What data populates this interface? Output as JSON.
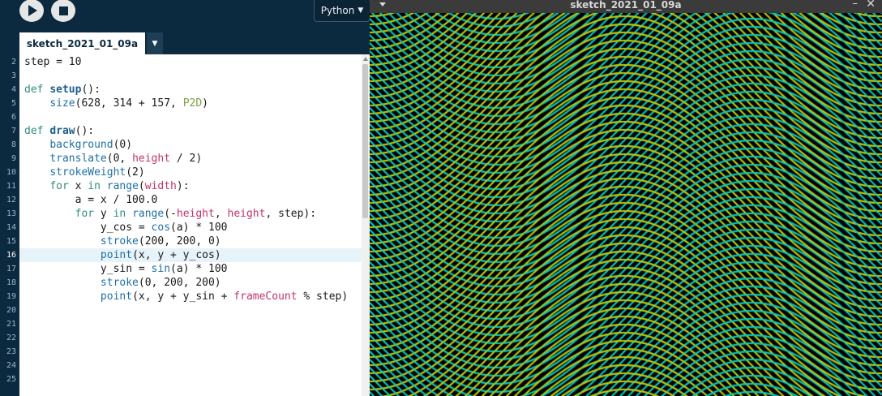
{
  "toolbar": {
    "run_icon": "play-icon",
    "stop_icon": "stop-icon",
    "mode_label": "Python",
    "mode_caret": "▼"
  },
  "tab": {
    "label": "sketch_2021_01_09a",
    "menu_caret": "▼"
  },
  "editor": {
    "active_line": "16",
    "line_numbers": [
      "2",
      "3",
      "4",
      "5",
      "6",
      "7",
      "8",
      "9",
      "10",
      "11",
      "12",
      "13",
      "14",
      "15",
      "16",
      "17",
      "18",
      "19",
      "20",
      "21",
      "22",
      "23",
      "24",
      "25"
    ],
    "colors": {
      "background": "#ffffff",
      "gutter": "#0b2a40",
      "highlight": "#e6f4fa"
    }
  },
  "sketch_window": {
    "title": "sketch_2021_01_09a",
    "minimize": "–",
    "close": "✕",
    "menu_icon": "menu-caret-icon",
    "colors": {
      "background": "#000000",
      "yellow_stroke": "#c8c800",
      "cyan_stroke": "#00c8c8"
    }
  },
  "code": [
    [
      [
        "plain",
        "step = 10"
      ]
    ],
    [],
    [
      [
        "kw",
        "def"
      ],
      [
        "plain",
        " "
      ],
      [
        "fn",
        "setup"
      ],
      [
        "plain",
        "():"
      ]
    ],
    [
      [
        "plain",
        "    "
      ],
      [
        "bi",
        "size"
      ],
      [
        "plain",
        "(628, 314 + 157, "
      ],
      [
        "lit",
        "P2D"
      ],
      [
        "plain",
        ")"
      ]
    ],
    [],
    [
      [
        "kw",
        "def"
      ],
      [
        "plain",
        " "
      ],
      [
        "fn",
        "draw"
      ],
      [
        "plain",
        "():"
      ]
    ],
    [
      [
        "plain",
        "    "
      ],
      [
        "bi",
        "background"
      ],
      [
        "plain",
        "(0)"
      ]
    ],
    [
      [
        "plain",
        "    "
      ],
      [
        "bi",
        "translate"
      ],
      [
        "plain",
        "(0, "
      ],
      [
        "vr",
        "height"
      ],
      [
        "plain",
        " / 2)"
      ]
    ],
    [
      [
        "plain",
        "    "
      ],
      [
        "bi",
        "strokeWeight"
      ],
      [
        "plain",
        "(2)"
      ]
    ],
    [
      [
        "plain",
        "    "
      ],
      [
        "kw",
        "for"
      ],
      [
        "plain",
        " x "
      ],
      [
        "kw",
        "in"
      ],
      [
        "plain",
        " "
      ],
      [
        "bi",
        "range"
      ],
      [
        "plain",
        "("
      ],
      [
        "vr",
        "width"
      ],
      [
        "plain",
        "):"
      ]
    ],
    [
      [
        "plain",
        "        a = x / 100.0"
      ]
    ],
    [
      [
        "plain",
        "        "
      ],
      [
        "kw",
        "for"
      ],
      [
        "plain",
        " y "
      ],
      [
        "kw",
        "in"
      ],
      [
        "plain",
        " "
      ],
      [
        "bi",
        "range"
      ],
      [
        "plain",
        "(-"
      ],
      [
        "vr",
        "height"
      ],
      [
        "plain",
        ", "
      ],
      [
        "vr",
        "height"
      ],
      [
        "plain",
        ", step):"
      ]
    ],
    [
      [
        "plain",
        "            y_cos = "
      ],
      [
        "bi",
        "cos"
      ],
      [
        "plain",
        "(a) * 100"
      ]
    ],
    [
      [
        "plain",
        "            "
      ],
      [
        "bi",
        "stroke"
      ],
      [
        "plain",
        "(200, 200, 0)"
      ]
    ],
    [
      [
        "plain",
        "            "
      ],
      [
        "bi",
        "point"
      ],
      [
        "plain",
        "(x, y + y_cos)"
      ]
    ],
    [
      [
        "plain",
        "            y_sin = "
      ],
      [
        "bi",
        "sin"
      ],
      [
        "plain",
        "(a) * 100"
      ]
    ],
    [
      [
        "plain",
        "            "
      ],
      [
        "bi",
        "stroke"
      ],
      [
        "plain",
        "(0, 200, 200)"
      ]
    ],
    [
      [
        "plain",
        "            "
      ],
      [
        "bi",
        "point"
      ],
      [
        "plain",
        "(x, y + y_sin + "
      ],
      [
        "vr",
        "frameCount"
      ],
      [
        "plain",
        " % step)"
      ]
    ],
    [],
    [],
    [],
    [],
    [],
    []
  ]
}
